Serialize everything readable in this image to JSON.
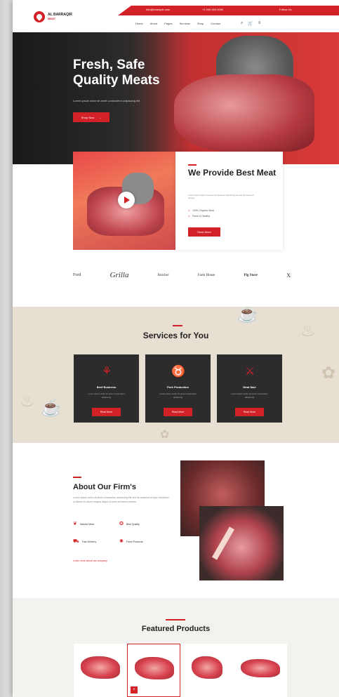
{
  "header": {
    "logo_name": "AL BARRAQIR",
    "logo_sub": "MEAT",
    "topbar": [
      "info@example.com",
      "+1 000 000 0000",
      "Follow Us"
    ],
    "nav": [
      "Home",
      "About",
      "Pages",
      "Services",
      "Shop",
      "Contact"
    ],
    "icons": [
      "search-icon",
      "cart-icon",
      "menu-icon"
    ]
  },
  "hero": {
    "title": "Fresh, Safe Quality Meats",
    "subtitle": "Lorem ipsum dolor sit amet consectetur adipiscing elit",
    "button": "Shop Now",
    "button_arrow": "→"
  },
  "provide": {
    "title": "We Provide Best Meat",
    "text": "Lorem ipsum dolor sit amet consectetur adipiscing elit sed do eiusmod tempor",
    "checks": [
      "100% Organic Meat",
      "Fresh & Healthy"
    ],
    "button": "Read More"
  },
  "brands": [
    "Ford",
    "Grilla",
    "Butcher",
    "Farm House",
    "Pig Store",
    "X"
  ],
  "services": {
    "title": "Services for You",
    "items": [
      {
        "title": "Beef Business",
        "text": "Lorem ipsum dolor sit amet consectetur adipiscing",
        "button": "Read More"
      },
      {
        "title": "Pork Production",
        "text": "Lorem ipsum dolor sit amet consectetur adipiscing",
        "button": "Read More"
      },
      {
        "title": "Meat Sale",
        "text": "Lorem ipsum dolor sit amet consectetur adipiscing",
        "button": "Read More"
      }
    ]
  },
  "about": {
    "title": "About Our Firm's",
    "text": "Lorem ipsum dolor sit amet consectetur adipiscing elit sed do eiusmod tempor incididunt ut labore et dolore magna aliqua ut enim ad minim veniam",
    "features": [
      "Natural Meat",
      "Best Quality",
      "Fast Delivery",
      "Fresh Products"
    ],
    "link": "Learn more about our company"
  },
  "products": {
    "title": "Featured Products",
    "cart_symbol": "+"
  },
  "colors": {
    "accent": "#d32128",
    "dark_card": "#2c2c2c",
    "services_bg": "#e7dfd1"
  }
}
